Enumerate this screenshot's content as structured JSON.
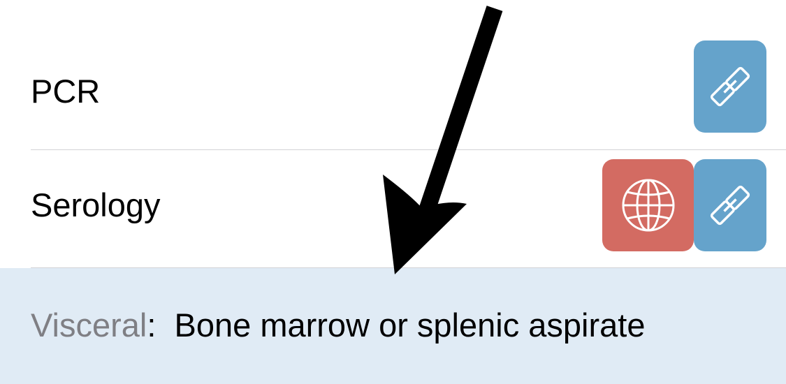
{
  "rows": [
    {
      "label": "PCR",
      "actions": [
        "link-icon"
      ]
    },
    {
      "label": "Serology",
      "actions": [
        "globe-icon",
        "link-icon"
      ]
    }
  ],
  "footer": {
    "key": "Visceral",
    "separator": ":",
    "value": "Bone marrow or splenic aspirate"
  },
  "colors": {
    "link_button": "#65a3cb",
    "web_button": "#d36b62",
    "footer_bg": "#e0ebf5",
    "key_text": "#7f7f84"
  }
}
